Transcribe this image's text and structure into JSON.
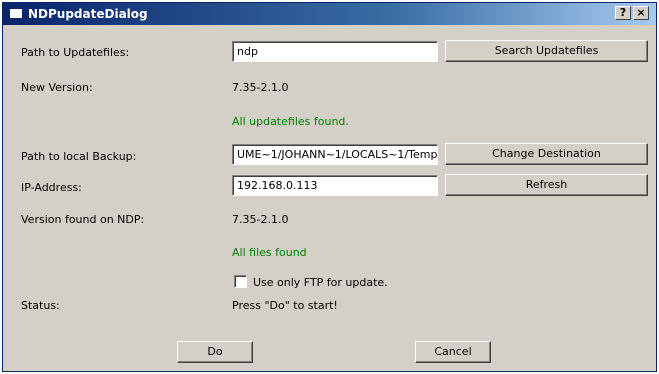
{
  "window": {
    "title": "NDPupdateDialog",
    "help_button": "?",
    "close_button": "×"
  },
  "form": {
    "path_updatefiles_label": "Path to Updatefiles:",
    "path_updatefiles_value": "ndp",
    "search_button": "Search Updatefiles",
    "new_version_label": "New Version:",
    "new_version_value": "7.35-2.1.0",
    "updatefiles_status": "All updatefiles found.",
    "backup_label": "Path to local Backup:",
    "backup_value": "UME~1/JOHANN~1/LOCALS~1/Temp",
    "change_dest_button": "Change Destination",
    "ip_label": "IP-Address:",
    "ip_value": "192.168.0.113",
    "refresh_button": "Refresh",
    "version_ndp_label": "Version found on NDP:",
    "version_ndp_value": "7.35-2.1.0",
    "files_status": "All files found",
    "ftp_checkbox_label": "Use only FTP for update.",
    "ftp_checked": false,
    "status_label": "Status:",
    "status_value": "Press \"Do\" to start!"
  },
  "footer": {
    "do_button": "Do",
    "cancel_button": "Cancel"
  },
  "colors": {
    "title_gradient_start": "#0a246a",
    "title_gradient_end": "#a6caf0",
    "success_text": "#008000",
    "dialog_bg": "#d4d0c8"
  }
}
